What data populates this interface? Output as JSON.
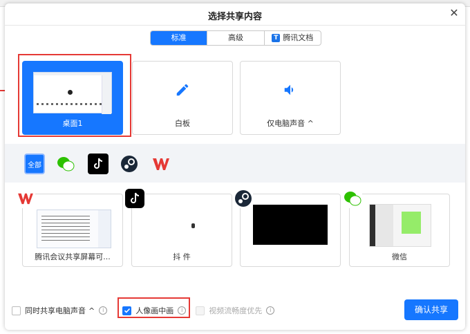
{
  "dialog": {
    "title": "选择共享内容",
    "close_icon": "close-icon"
  },
  "tabs": [
    {
      "label": "标准",
      "active": true
    },
    {
      "label": "高级",
      "active": false
    },
    {
      "label": "腾讯文档",
      "active": false,
      "icon": "tencent-docs-icon"
    }
  ],
  "share_cards": [
    {
      "label": "桌面1",
      "selected": true,
      "icon": "desktop-thumbnail"
    },
    {
      "label": "白板",
      "selected": false,
      "icon": "pen-icon"
    },
    {
      "label": "仅电脑声音",
      "selected": false,
      "icon": "speaker-icon",
      "caret": "^"
    }
  ],
  "filters": [
    {
      "label": "全部",
      "icon": "all-icon",
      "active": true
    },
    {
      "label": "",
      "icon": "wechat-icon"
    },
    {
      "label": "",
      "icon": "tiktok-icon"
    },
    {
      "label": "",
      "icon": "steam-icon"
    },
    {
      "label": "",
      "icon": "wps-icon"
    }
  ],
  "app_windows": [
    {
      "label": "腾讯会议共享屏幕可...",
      "icon": "wps-icon"
    },
    {
      "label": "抖       件",
      "icon": "tiktok-icon"
    },
    {
      "label": "",
      "icon": "steam-icon"
    },
    {
      "label": "微信",
      "icon": "wechat-icon"
    }
  ],
  "options": {
    "share_audio_label": "同时共享电脑声音",
    "share_audio_caret": "^",
    "pip_label": "人像画中画",
    "pip_checked": true,
    "video_smooth_label": "视频流畅度优先",
    "video_smooth_disabled": true
  },
  "confirm_label": "确认共享",
  "colors": {
    "accent": "#1677ff",
    "highlight_red": "#e53935"
  }
}
